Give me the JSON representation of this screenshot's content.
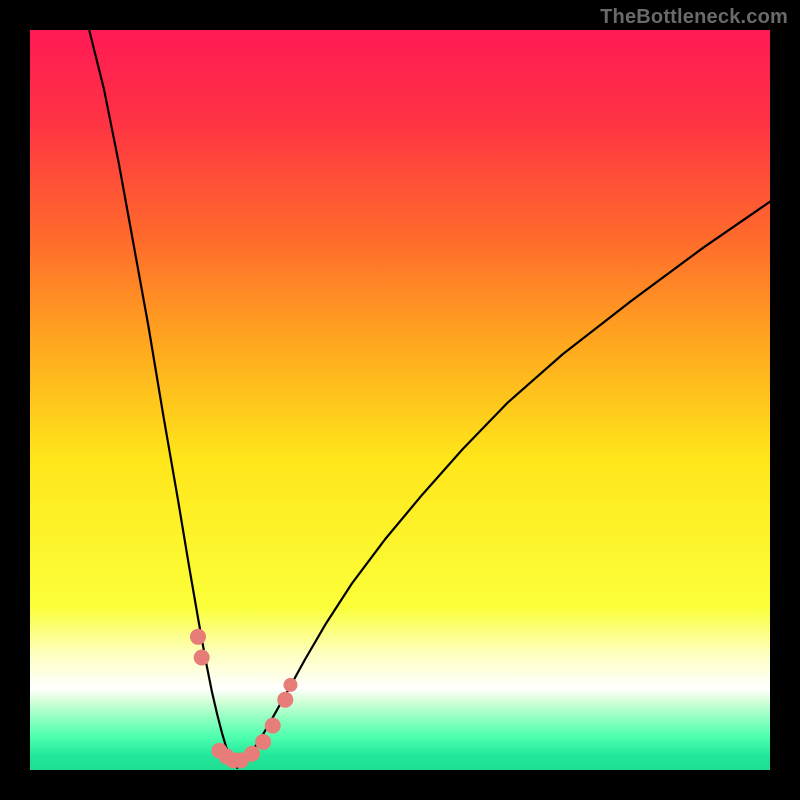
{
  "watermark": "TheBottleneck.com",
  "colors": {
    "frame": "#000000",
    "gradient_stops": [
      {
        "offset": 0.0,
        "color": "#ff1a55"
      },
      {
        "offset": 0.12,
        "color": "#ff3244"
      },
      {
        "offset": 0.28,
        "color": "#ff6a2c"
      },
      {
        "offset": 0.42,
        "color": "#ffa61f"
      },
      {
        "offset": 0.58,
        "color": "#ffe61a"
      },
      {
        "offset": 0.78,
        "color": "#fbff3a"
      },
      {
        "offset": 0.84,
        "color": "#fdffba"
      },
      {
        "offset": 0.89,
        "color": "#ffffff"
      },
      {
        "offset": 0.905,
        "color": "#d9ffdb"
      },
      {
        "offset": 0.93,
        "color": "#8fffc0"
      },
      {
        "offset": 0.955,
        "color": "#4effaf"
      },
      {
        "offset": 0.98,
        "color": "#22e89b"
      },
      {
        "offset": 1.0,
        "color": "#1fde93"
      }
    ],
    "curve": "#000000",
    "markers_fill": "#e77d79",
    "markers_stroke": "#c85b57"
  },
  "chart_data": {
    "type": "line",
    "title": "",
    "xlabel": "",
    "ylabel": "",
    "xlim": [
      0,
      100
    ],
    "ylim": [
      0,
      100
    ],
    "x_min_point": 28,
    "series": [
      {
        "name": "left-branch",
        "x": [
          8.0,
          10.0,
          12.0,
          14.0,
          16.0,
          18.0,
          20.0,
          21.5,
          22.8,
          23.8,
          24.6,
          25.3,
          26.0,
          26.6,
          27.3,
          28.0
        ],
        "y": [
          100.0,
          92.0,
          82.0,
          71.0,
          60.0,
          48.0,
          36.5,
          27.5,
          20.0,
          14.5,
          10.5,
          7.5,
          4.8,
          2.8,
          1.2,
          0.3
        ]
      },
      {
        "name": "right-branch",
        "x": [
          28.0,
          29.0,
          30.2,
          31.6,
          33.2,
          35.0,
          37.2,
          40.0,
          43.5,
          48.0,
          53.0,
          58.5,
          64.5,
          72.0,
          81.0,
          91.0,
          100.0
        ],
        "y": [
          0.3,
          1.2,
          2.8,
          5.0,
          7.8,
          11.0,
          15.0,
          19.8,
          25.2,
          31.2,
          37.2,
          43.4,
          49.6,
          56.2,
          63.2,
          70.6,
          76.8
        ]
      }
    ],
    "markers": [
      {
        "x": 22.7,
        "y": 18.0,
        "r": 8
      },
      {
        "x": 23.2,
        "y": 15.2,
        "r": 8
      },
      {
        "x": 25.6,
        "y": 2.6,
        "r": 8
      },
      {
        "x": 26.6,
        "y": 1.8,
        "r": 8
      },
      {
        "x": 27.5,
        "y": 1.3,
        "r": 8
      },
      {
        "x": 28.5,
        "y": 1.3,
        "r": 8
      },
      {
        "x": 30.0,
        "y": 2.2,
        "r": 8
      },
      {
        "x": 31.5,
        "y": 3.8,
        "r": 8
      },
      {
        "x": 32.8,
        "y": 6.0,
        "r": 8
      },
      {
        "x": 34.5,
        "y": 9.5,
        "r": 8
      },
      {
        "x": 35.2,
        "y": 11.5,
        "r": 7
      }
    ]
  }
}
